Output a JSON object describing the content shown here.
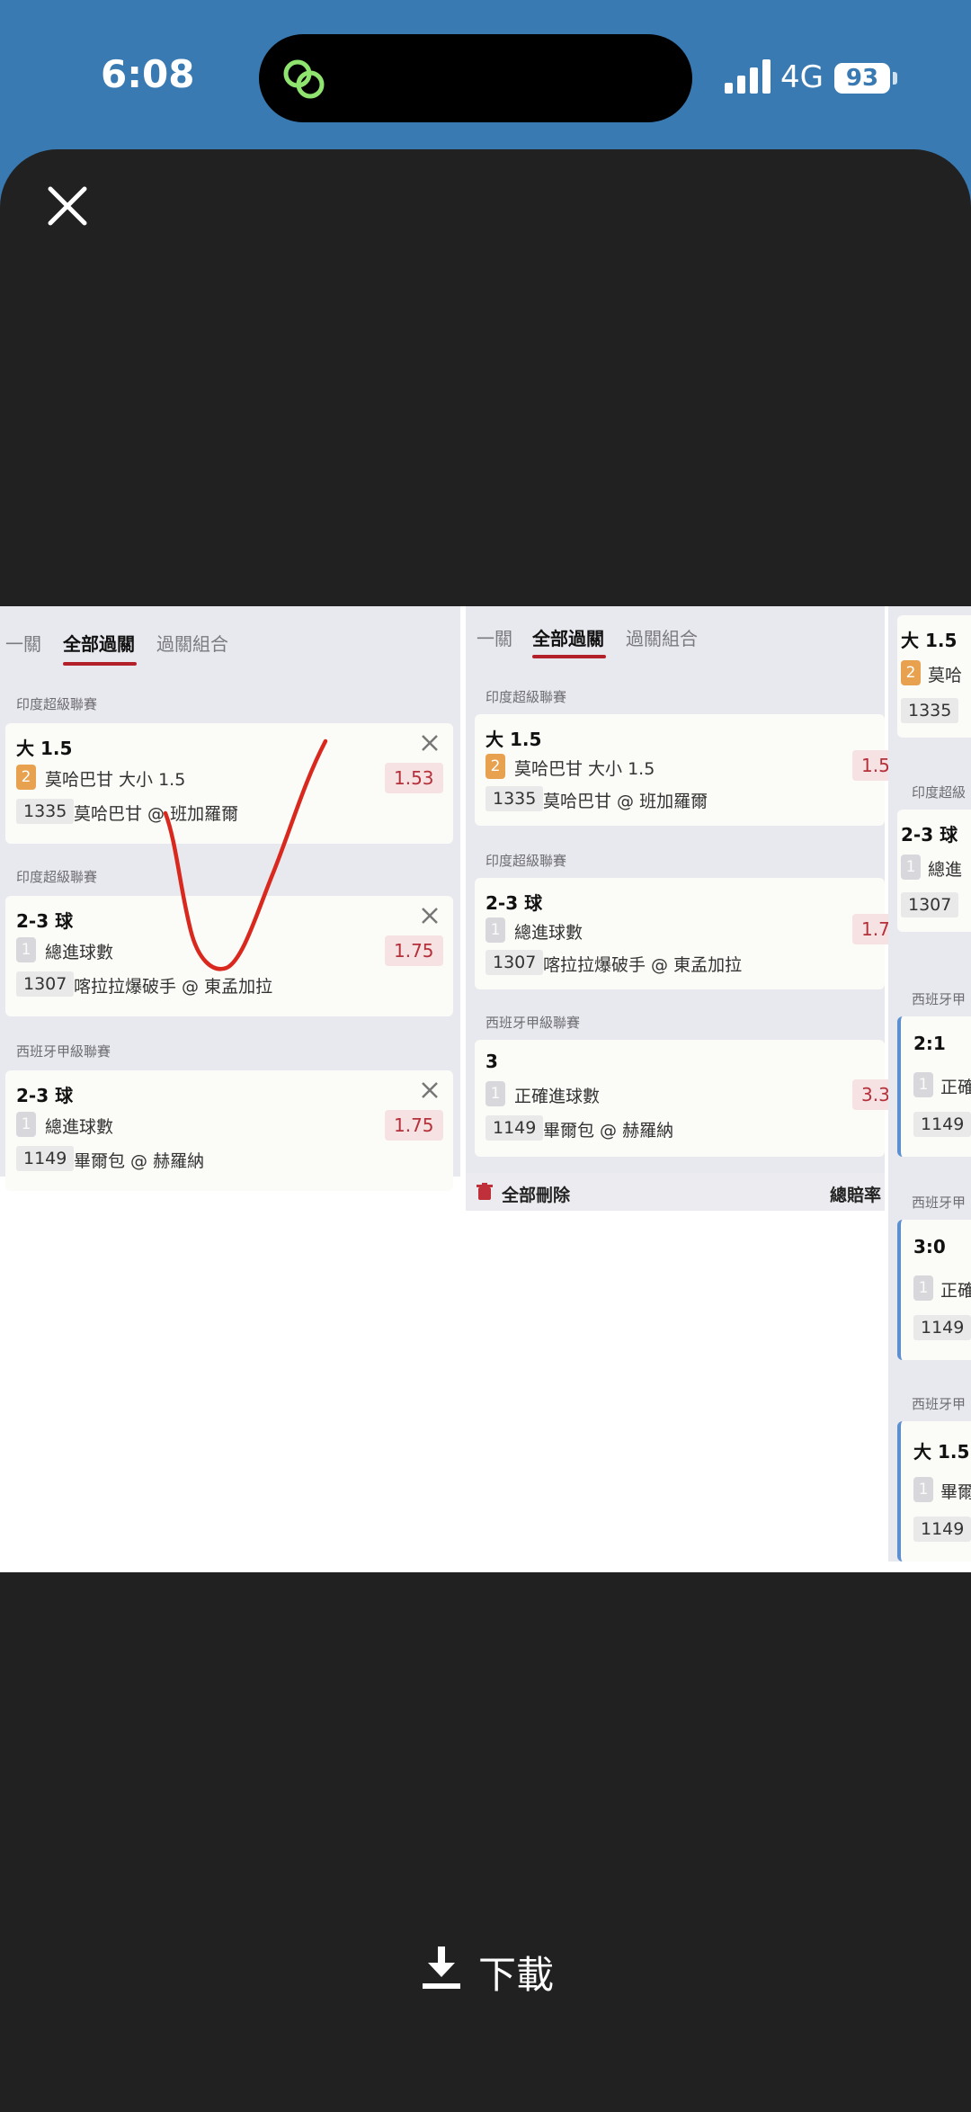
{
  "status_bar": {
    "time": "6:08",
    "network": "4G",
    "battery": "93"
  },
  "viewer": {
    "download_label": "下載"
  },
  "photo": {
    "panel1": {
      "tabs": [
        "一關",
        "全部過關",
        "過關組合"
      ],
      "active_tab": "全部過關",
      "bets": [
        {
          "league": "印度超級聯賽",
          "title": "大 1.5",
          "badge": "2",
          "bet": "莫哈巴甘 大小 1.5",
          "odds": "1.53",
          "code": "1335",
          "match": "莫哈巴甘 @ 班加羅爾"
        },
        {
          "league": "印度超級聯賽",
          "title": "2-3 球",
          "badge": "1",
          "bet": "總進球數",
          "odds": "1.75",
          "code": "1307",
          "match": "喀拉拉爆破手 @ 東孟加拉"
        },
        {
          "league": "西班牙甲級聯賽",
          "title": "2-3 球",
          "badge": "1",
          "bet": "總進球數",
          "odds": "1.75",
          "code": "1149",
          "match": "畢爾包 @ 赫羅納"
        }
      ]
    },
    "panel2": {
      "tabs": [
        "一關",
        "全部過關",
        "過關組合"
      ],
      "active_tab": "全部過關",
      "bets": [
        {
          "league": "印度超級聯賽",
          "title": "大 1.5",
          "badge": "2",
          "bet": "莫哈巴甘 大小 1.5",
          "odds": "1.5",
          "code": "1335",
          "match": "莫哈巴甘 @ 班加羅爾"
        },
        {
          "league": "印度超級聯賽",
          "title": "2-3 球",
          "badge": "1",
          "bet": "總進球數",
          "odds": "1.7",
          "code": "1307",
          "match": "喀拉拉爆破手 @ 東孟加拉"
        },
        {
          "league": "西班牙甲級聯賽",
          "title": "3",
          "badge": "1",
          "bet": "正確進球數",
          "odds": "3.3",
          "code": "1149",
          "match": "畢爾包 @ 赫羅納"
        }
      ],
      "delete_all": "全部刪除",
      "total_odds": "總賠率"
    },
    "panel3": {
      "cards": [
        {
          "league": "",
          "title": "大 1.5",
          "badge": "2",
          "bet": "莫哈",
          "code": "1335"
        },
        {
          "league": "印度超級",
          "title": "2-3 球",
          "badge": "1",
          "bet": "總進",
          "code": "1307"
        },
        {
          "league": "西班牙甲",
          "title": "2:1",
          "badge": "1",
          "bet": "正確",
          "code": "1149"
        },
        {
          "league": "西班牙甲",
          "title": "3:0",
          "badge": "1",
          "bet": "正確",
          "code": "1149"
        },
        {
          "league": "西班牙甲",
          "title": "大 1.5",
          "badge": "1",
          "bet": "畢爾",
          "code": "1149"
        }
      ]
    }
  },
  "colors": {
    "status_bar": "#3a7ab3",
    "viewer_bg": "#212121",
    "accent_red": "#b4202a",
    "annotation": "#d9281e"
  }
}
